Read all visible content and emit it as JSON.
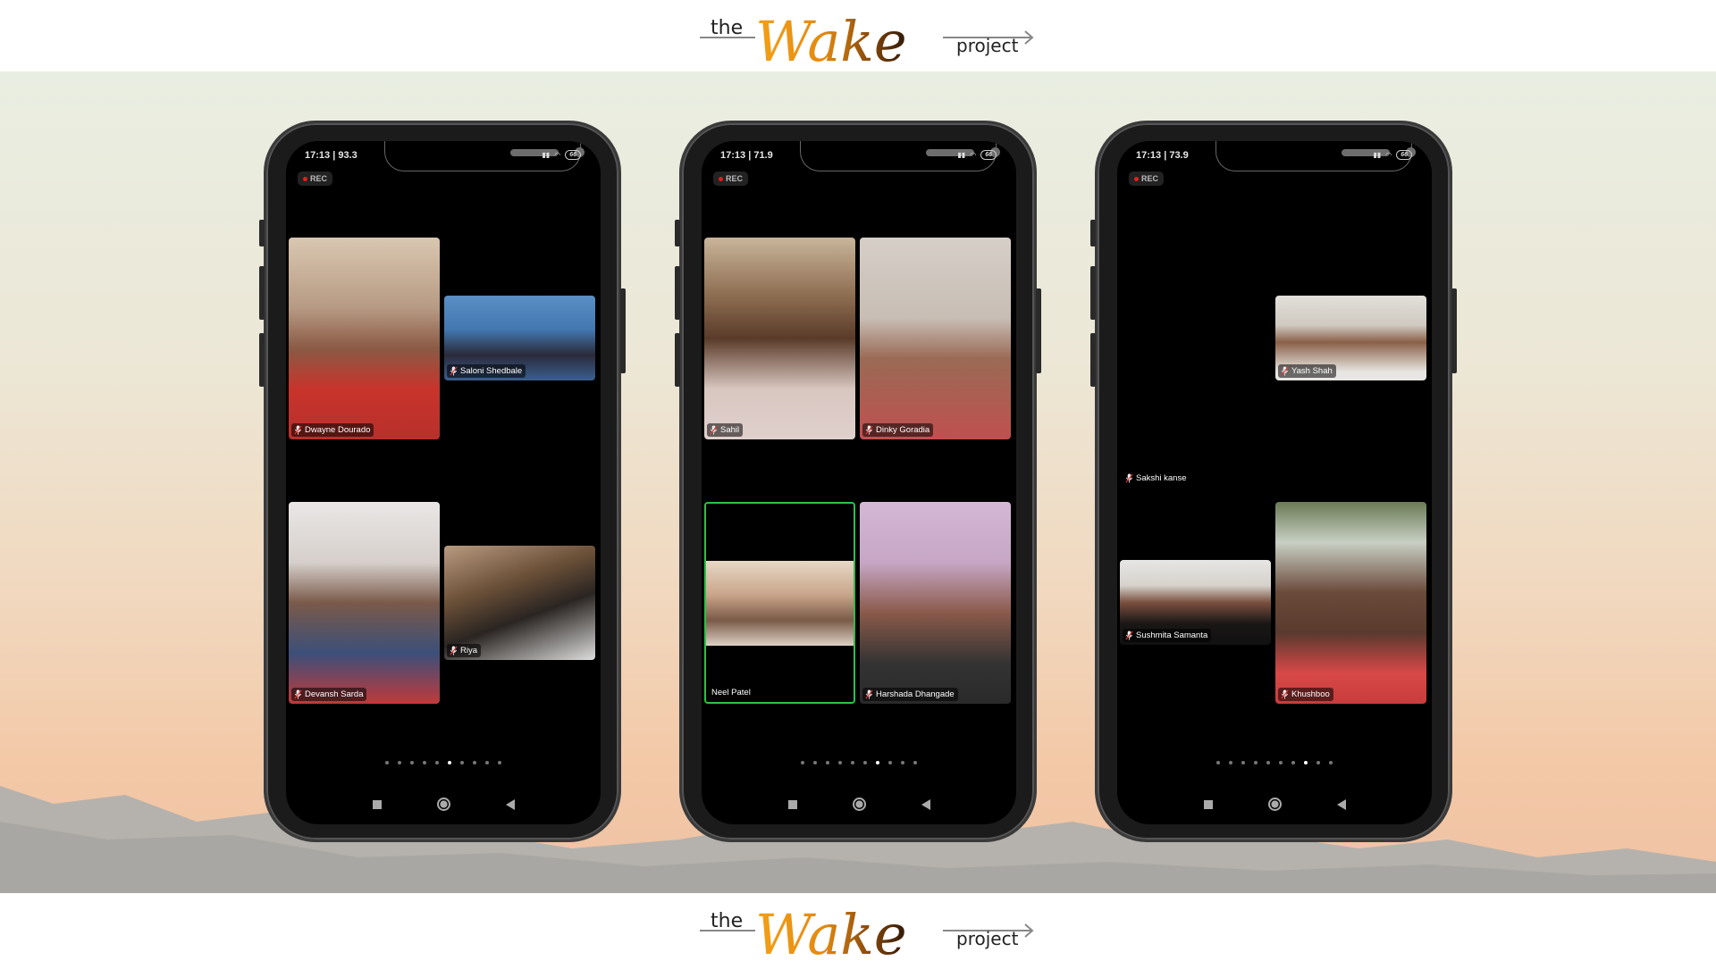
{
  "logo": {
    "the": "the",
    "wake": "Wake",
    "project": "project"
  },
  "phones": [
    {
      "status_time": "17:13 | 93.3",
      "battery": "66",
      "rec_label": "REC",
      "participants": [
        "Dwayne Dourado",
        "Saloni Shedbale",
        "Devansh Sarda",
        "Riya"
      ],
      "page_dots": 10,
      "active_page": 6
    },
    {
      "status_time": "17:13 | 71.9",
      "battery": "66",
      "rec_label": "REC",
      "participants": [
        "Sahil",
        "Dinky Goradia",
        "Neel Patel",
        "Harshada Dhangade"
      ],
      "active_speaker": "Neel Patel",
      "page_dots": 10,
      "active_page": 7
    },
    {
      "status_time": "17:13 | 73.9",
      "battery": "66",
      "rec_label": "REC",
      "participants": [
        "Yash Shah",
        "Sakshi kanse",
        "Sushmita Samanta",
        "Khushboo"
      ],
      "page_dots": 10,
      "active_page": 8
    }
  ],
  "colors": {
    "active_speaker_border": "#2fbf4a",
    "logo_orange": "#f29a12",
    "logo_brown": "#3a1f0a"
  }
}
